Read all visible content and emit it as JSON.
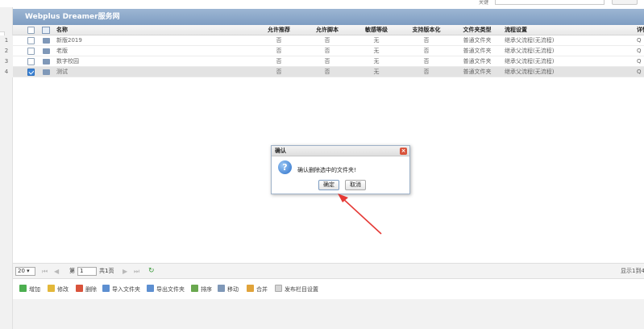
{
  "search": {
    "label": "关键",
    "placeholder": "",
    "button_label": ""
  },
  "panel": {
    "title": "Webplus Dreamer服务网"
  },
  "grid": {
    "columns": [
      "名称",
      "允许推荐",
      "允许脚本",
      "敏感等级",
      "支持版本化",
      "文件夹类型",
      "流程设置",
      "详情"
    ],
    "rows": [
      {
        "num": "1",
        "checked": false,
        "name": "新版2019",
        "recommend": "否",
        "script": "否",
        "sensitivity": "无",
        "versioning": "否",
        "folder_type": "普通文件夹",
        "flow": "继承父流程(无流程)",
        "more": "Q"
      },
      {
        "num": "2",
        "checked": false,
        "name": "老版",
        "recommend": "否",
        "script": "否",
        "sensitivity": "无",
        "versioning": "否",
        "folder_type": "普通文件夹",
        "flow": "继承父流程(无流程)",
        "more": "Q"
      },
      {
        "num": "3",
        "checked": false,
        "name": "数字校园",
        "recommend": "否",
        "script": "否",
        "sensitivity": "无",
        "versioning": "否",
        "folder_type": "普通文件夹",
        "flow": "继承父流程(无流程)",
        "more": "Q"
      },
      {
        "num": "4",
        "checked": true,
        "name": "测试",
        "recommend": "否",
        "script": "否",
        "sensitivity": "无",
        "versioning": "否",
        "folder_type": "普通文件夹",
        "flow": "继承父流程(无流程)",
        "more": "Q"
      }
    ]
  },
  "pager": {
    "page_size": "20",
    "page_prefix": "第",
    "current_page": "1",
    "total_pages": "共1页",
    "info": "显示1到4"
  },
  "toolbar": {
    "add": "增加",
    "edit": "修改",
    "delete": "删除",
    "import_folder": "导入文件夹",
    "export_folder": "导出文件夹",
    "sort": "排序",
    "move": "移动",
    "merge": "合并",
    "publish_column": "发布栏目设置"
  },
  "dialog": {
    "title": "确认",
    "message": "确认删除选中的文件夹!",
    "ok": "确定",
    "cancel": "取消"
  },
  "colors": {
    "header_bar": "#8fa9ca",
    "selected_row": "#e3e3e3",
    "annotation_arrow": "#e53935"
  }
}
